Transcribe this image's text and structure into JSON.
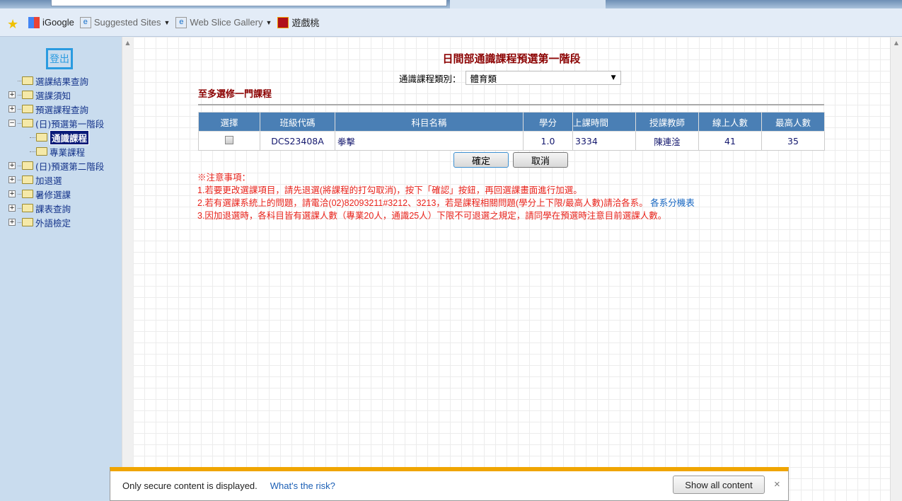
{
  "favorites": [
    {
      "label": "iGoogle"
    },
    {
      "label": "Suggested Sites"
    },
    {
      "label": "Web Slice Gallery"
    },
    {
      "label": "遊戲桃"
    }
  ],
  "sidebar": {
    "logout": "登出",
    "items": [
      {
        "label": "選課結果查詢"
      },
      {
        "label": "選課須知"
      },
      {
        "label": "預選課程查詢"
      },
      {
        "label": "(日)預選第一階段"
      },
      {
        "label": "通識課程"
      },
      {
        "label": "專業課程"
      },
      {
        "label": "(日)預選第二階段"
      },
      {
        "label": "加退選"
      },
      {
        "label": "暑修選課"
      },
      {
        "label": "課表查詢"
      },
      {
        "label": "外語檢定"
      }
    ]
  },
  "main": {
    "title": "日間部通識課程預選第一階段",
    "category_label": "通識課程類別：",
    "category_value": "體育類",
    "limit": "至多選修一門課程",
    "headers": [
      "選擇",
      "班級代碼",
      "科目名稱",
      "學分",
      "上課時間",
      "授課教師",
      "線上人數",
      "最高人數"
    ],
    "rows": [
      {
        "code": "DCS23408A",
        "name": "拳擊",
        "credit": "1.0",
        "time": "3334",
        "teacher": "陳連淦",
        "online": "41",
        "max": "35"
      }
    ],
    "ok": "確定",
    "cancel": "取消",
    "notes": [
      "※注意事項：",
      "1.若要更改選課項目，請先退選(將課程的打勾取消)，按下「確認」按鈕，再回選課畫面進行加選。",
      "2.若有選課系統上的問題，請電洽(02)82093211#3212、3213，若是課程相關問題(學分上下限/最高人數)請洽各系。",
      "3.因加退選時，各科目皆有選課人數（專業20人，通識25人）下限不可退選之規定，請同學在預選時注意目前選課人數。"
    ],
    "dept_link": "各系分機表"
  },
  "notification": {
    "message": "Only secure content is displayed.",
    "risk_link": "What's the risk?",
    "show_all": "Show all content",
    "close": "×"
  }
}
